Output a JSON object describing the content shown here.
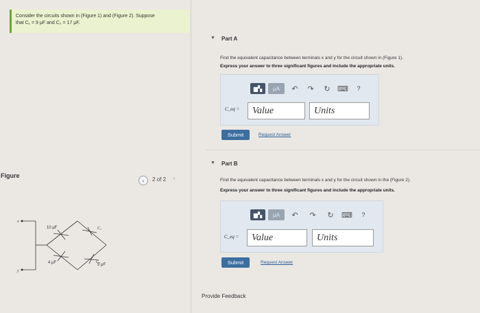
{
  "problem": {
    "line1": "Consider the circuits shown in (Figure 1) and (Figure 2). Suppose",
    "line2": "that C₁ = 9 μF and C₂ = 17 μF."
  },
  "figure": {
    "label": "Figure",
    "pager": "2 of 2",
    "prev_icon": "chevron-left-icon",
    "next_icon": "chevron-right-icon",
    "labels": {
      "x": "x",
      "y": "y",
      "c10": "10 μF",
      "c1": "C₁",
      "c2": "C₂",
      "c4": "4 μF",
      "c5": "5 μF"
    }
  },
  "partA": {
    "title": "Part A",
    "question": "Find the equivalent capacitance between terminals x and y for the circuit shown in (Figure 1).",
    "instruction": "Express your answer to three significant figures and include the appropriate units.",
    "toolbar": {
      "mu": "μA",
      "help": "?"
    },
    "ceq_label": "C_eq =",
    "value_placeholder": "Value",
    "units_placeholder": "Units",
    "submit": "Submit",
    "request": "Request Answer"
  },
  "partB": {
    "title": "Part B",
    "question": "Find the equivalent capacitance between terminals x and y for the circuit shown in the (Figure 2).",
    "instruction": "Express your answer to three significant figures and include the appropriate units.",
    "toolbar": {
      "mu": "μA",
      "help": "?"
    },
    "ceq_label": "C_eq =",
    "value_placeholder": "Value",
    "units_placeholder": "Units",
    "submit": "Submit",
    "request": "Request Answer"
  },
  "footer": {
    "feedback": "Provide Feedback"
  },
  "colors": {
    "accent": "#3c6e9f",
    "problem_bg": "#ebf2cf",
    "panel_bg": "#e2e8ef"
  }
}
